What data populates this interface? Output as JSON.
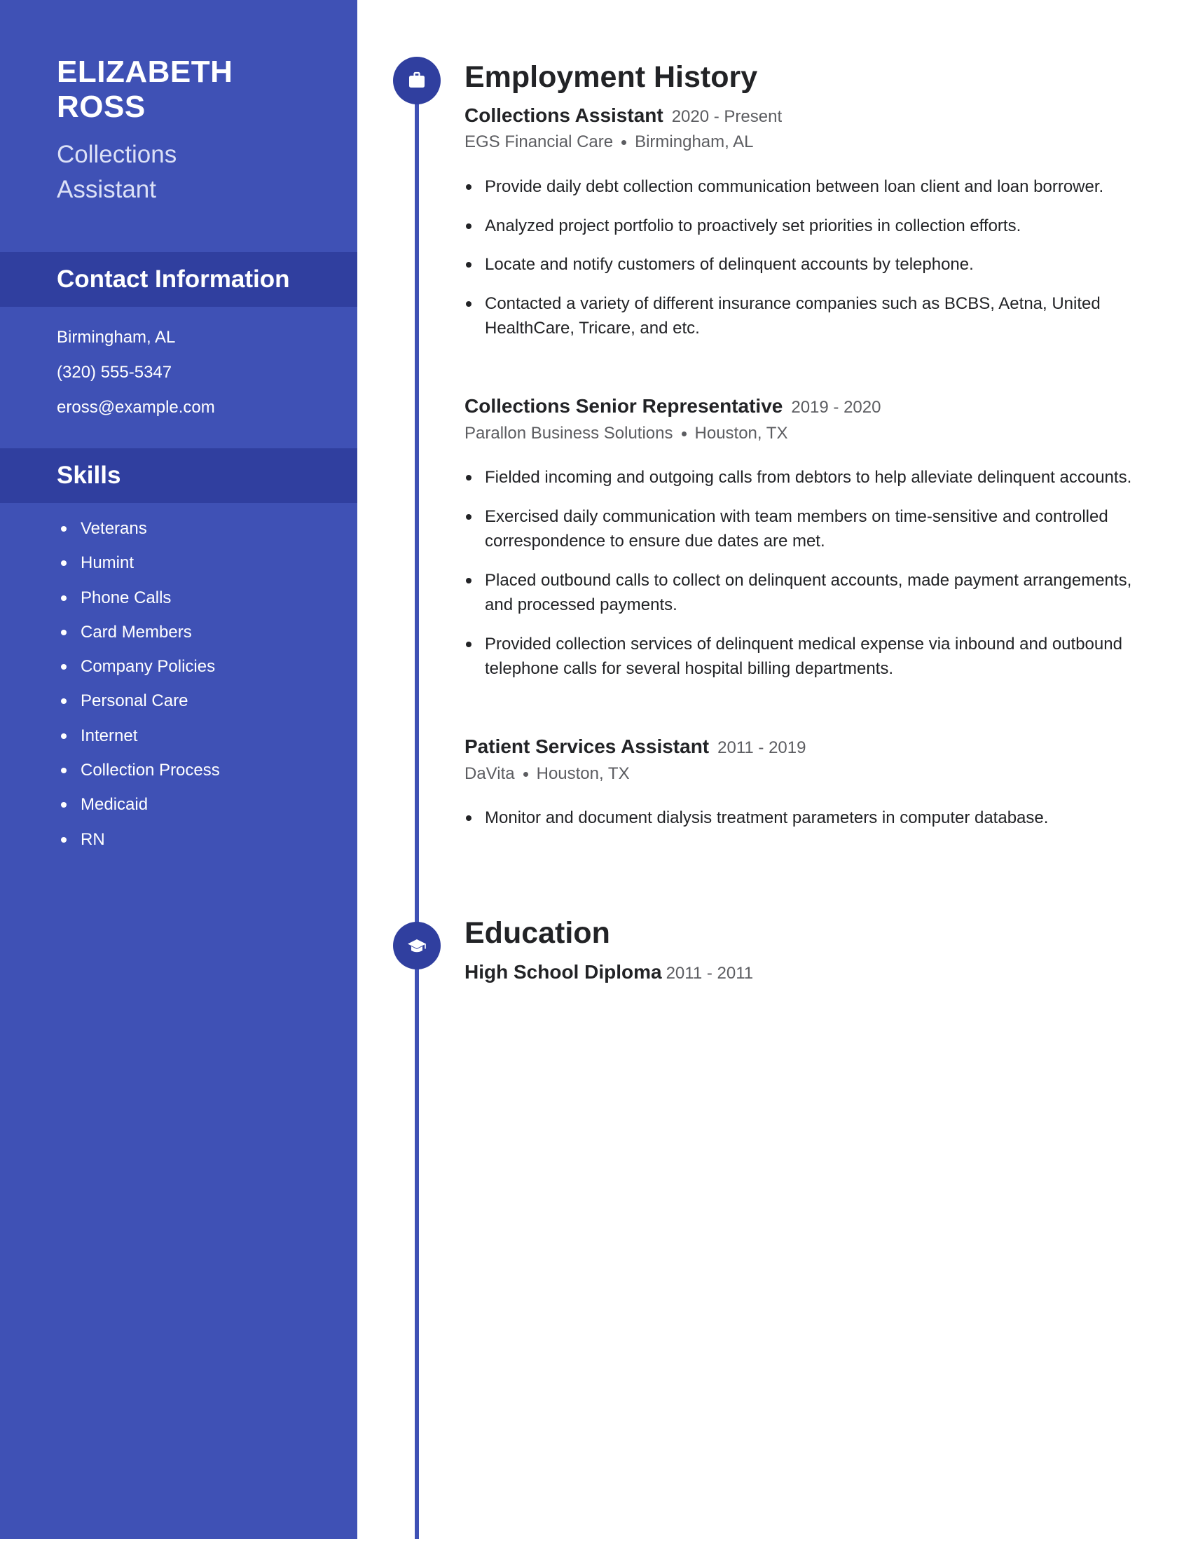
{
  "profile": {
    "name_line1": "ELIZABETH",
    "name_line2": "ROSS",
    "title_line1": "Collections",
    "title_line2": "Assistant"
  },
  "contact": {
    "heading": "Contact Information",
    "location": "Birmingham, AL",
    "phone": "(320) 555-5347",
    "email": "eross@example.com"
  },
  "skills": {
    "heading": "Skills",
    "items": [
      "Veterans",
      "Humint",
      "Phone Calls",
      "Card Members",
      "Company Policies",
      "Personal Care",
      "Internet",
      "Collection Process",
      "Medicaid",
      "RN"
    ]
  },
  "employment": {
    "heading": "Employment History",
    "icon": "briefcase-icon",
    "jobs": [
      {
        "role": "Collections Assistant",
        "dates": "2020 - Present",
        "company": "EGS Financial Care",
        "location": "Birmingham, AL",
        "bullets": [
          "Provide daily debt collection communication between loan client and loan borrower.",
          "Analyzed project portfolio to proactively set priorities in collection efforts.",
          "Locate and notify customers of delinquent accounts by telephone.",
          "Contacted a variety of different insurance companies such as BCBS, Aetna, United HealthCare, Tricare, and etc."
        ]
      },
      {
        "role": "Collections Senior Representative",
        "dates": "2019 - 2020",
        "company": "Parallon Business Solutions",
        "location": "Houston, TX",
        "bullets": [
          "Fielded incoming and outgoing calls from debtors to help alleviate delinquent accounts.",
          "Exercised daily communication with team members on time-sensitive and controlled correspondence to ensure due dates are met.",
          "Placed outbound calls to collect on delinquent accounts, made payment arrangements, and processed payments.",
          "Provided collection services of delinquent medical expense via inbound and outbound telephone calls for several hospital billing departments."
        ]
      },
      {
        "role": "Patient Services Assistant",
        "dates": "2011 - 2019",
        "company": "DaVita",
        "location": "Houston, TX",
        "bullets": [
          "Monitor and document dialysis treatment parameters in computer database."
        ]
      }
    ]
  },
  "education": {
    "heading": "Education",
    "icon": "graduation-cap-icon",
    "entries": [
      {
        "degree": "High School Diploma",
        "dates": "2011 - 2011"
      }
    ]
  },
  "colors": {
    "sidebar": "#3f51b5",
    "sidebar_band": "#303f9f",
    "timeline": "#3f51b5",
    "text_primary": "#222326",
    "text_secondary": "#5c5d61"
  }
}
